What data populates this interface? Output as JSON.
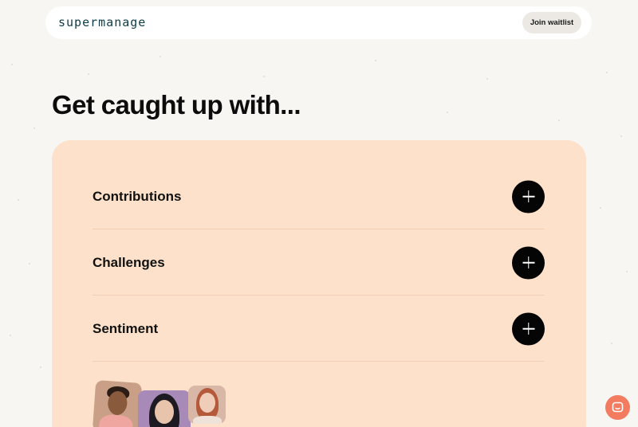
{
  "nav": {
    "logo_text": "supermanage",
    "join_button_label": "Join waitlist"
  },
  "hero": {
    "headline": "Get caught up with..."
  },
  "accordion": {
    "items": [
      {
        "label": "Contributions",
        "icon": "plus-icon"
      },
      {
        "label": "Challenges",
        "icon": "plus-icon"
      },
      {
        "label": "Sentiment",
        "icon": "plus-icon"
      }
    ]
  },
  "avatars": [
    {
      "icon": "person-avatar"
    },
    {
      "icon": "person-avatar"
    },
    {
      "icon": "person-avatar"
    }
  ],
  "chat_widget": {
    "icon": "chat-bubble-icon"
  },
  "colors": {
    "page_background": "#f8f6f3",
    "panel_background": "#fde1ca",
    "accent_button": "#050505",
    "chat_button": "#f37b5f",
    "logo": "#0f3b44"
  }
}
